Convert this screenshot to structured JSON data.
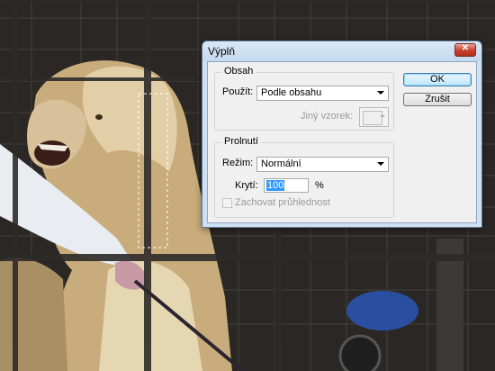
{
  "dialog": {
    "title": "Výplň",
    "contents_group": {
      "label": "Obsah",
      "use_label": "Použít:",
      "use_value": "Podle obsahu",
      "custom_pattern_label": "Jiný vzorek:"
    },
    "blending_group": {
      "label": "Prolnutí",
      "mode_label": "Režim:",
      "mode_value": "Normální",
      "opacity_label": "Krytí:",
      "opacity_value": "100",
      "opacity_unit": "%",
      "preserve_transparency_label": "Zachovat průhlednost",
      "preserve_transparency_checked": false
    },
    "buttons": {
      "ok": "OK",
      "cancel": "Zrušit"
    }
  },
  "colors": {
    "titlebar": "#c5d9ef",
    "close_button": "#c7402b",
    "selection": "#3399ff"
  },
  "icons": [
    "close-icon",
    "chevron-down-icon"
  ]
}
